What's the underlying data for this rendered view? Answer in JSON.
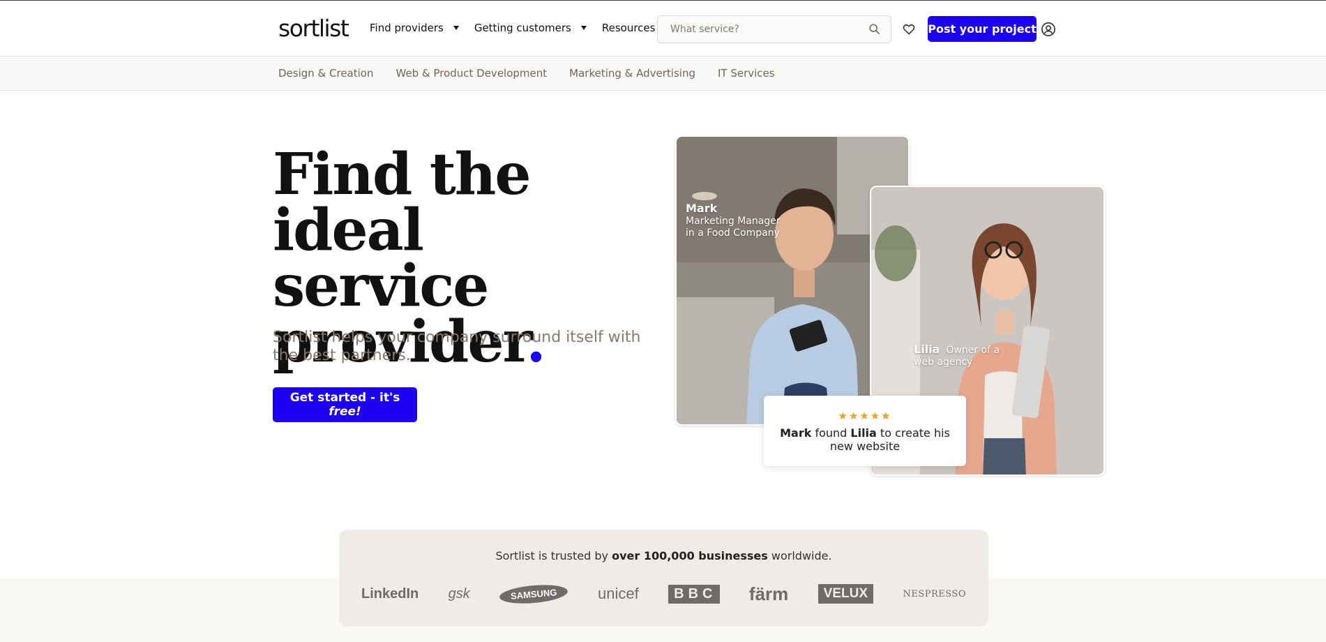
{
  "header": {
    "logo": "sortlist",
    "nav": [
      "Find providers",
      "Getting customers",
      "Resources"
    ],
    "search_placeholder": "What service?",
    "post_button": "Post your project"
  },
  "categories": [
    "Design & Creation",
    "Web & Product Development",
    "Marketing & Advertising",
    "IT Services"
  ],
  "hero": {
    "title_lines": [
      "Find the ideal",
      "service",
      "provider"
    ],
    "title_dot": ".",
    "subtitle": "Sortlist helps your company surround itself with the best partners.",
    "cta_main": "Get started - it's ",
    "cta_em": "free!"
  },
  "cards": {
    "mark_name": "Mark",
    "mark_role_1": "Marketing Manager",
    "mark_role_2": "in a Food Company",
    "lilia_name": "Lilia",
    "lilia_role_1": "Owner of a",
    "lilia_role_2": "web agency",
    "stars": "★★★★★",
    "review_name_1": "Mark",
    "review_text_1": " found ",
    "review_name_2": "Lilia",
    "review_text_2": " to create his new website"
  },
  "trust": {
    "prefix": "Sortlist is trusted by ",
    "bold": "over 100,000 businesses",
    "suffix": " worldwide.",
    "logos": [
      "LinkedIn",
      "gsk",
      "SAMSUNG",
      "unicef",
      "BBC",
      "färm",
      "VELUX",
      "NESPRESSO"
    ]
  },
  "colors": {
    "accent": "#1d00f0",
    "subtitle": "#857970",
    "category_text": "#6b655e",
    "star": "#f0a020",
    "trust_bg": "#efebe7"
  }
}
